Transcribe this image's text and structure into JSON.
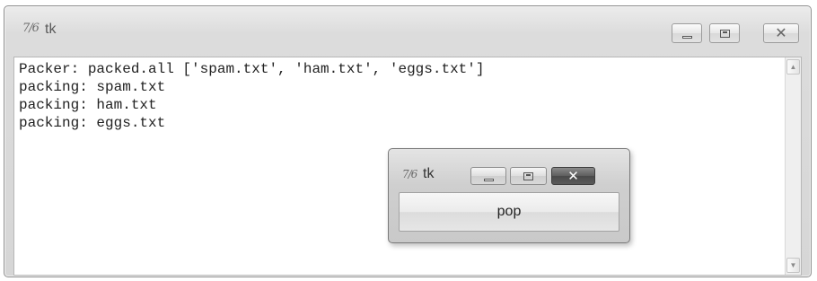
{
  "main_window": {
    "app_glyph": "7/6",
    "title": "tk",
    "lines": [
      "Packer: packed.all ['spam.txt', 'ham.txt', 'eggs.txt']",
      "packing: spam.txt",
      "packing: ham.txt",
      "packing: eggs.txt"
    ],
    "caption_icons": [
      "minimize-icon",
      "maximize-icon",
      "close-icon"
    ]
  },
  "popup_window": {
    "app_glyph": "7/6",
    "title": "tk",
    "button_label": "pop",
    "close_color": "#4a4a4a"
  },
  "scrollbar": {
    "up_arrow": "▲",
    "down_arrow": "▼"
  }
}
